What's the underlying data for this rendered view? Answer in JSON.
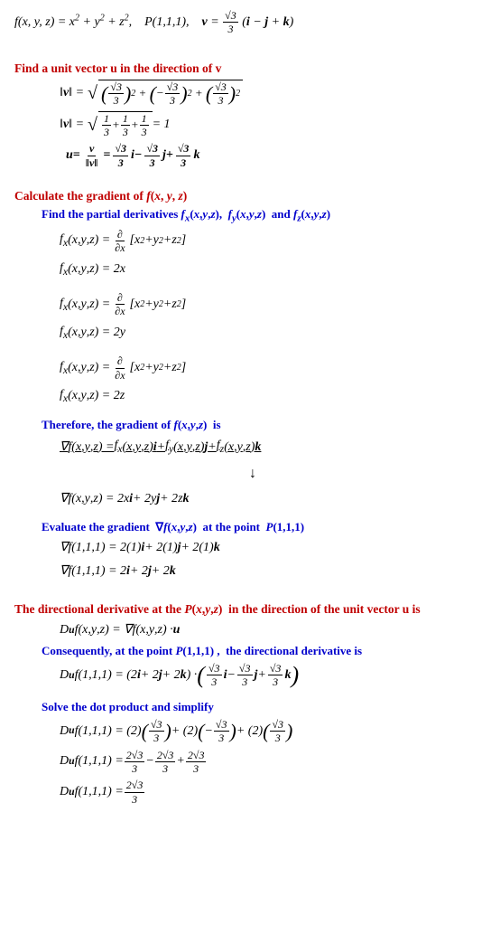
{
  "top": {
    "func_def": "f(x, y, z) = x² + y² + z²",
    "point_def": "P(1,1,1)",
    "v_def": "v = (√3/3)(i − j + k)"
  },
  "section1": {
    "title": "Find a unit vector u in the direction of v",
    "norm_eq1": "‖v‖ = √( (√3/3)² + (−√3/3)² + (√3/3)² )",
    "norm_eq2": "‖v‖ = √(1/3 + 1/3 + 1/3) = 1",
    "u_eq": "u = v/‖v‖ = (√3/3)i − (√3/3)j + (√3/3)k"
  },
  "section2": {
    "title": "Calculate the gradient of f(x, y, z)",
    "subsection": "Find the partial derivatives fₓ(x,y,z), f_y(x,y,z) and f_z(x,y,z)",
    "fx1": "fₓ(x,y,z) = ∂/∂x [x² + y² + z²]",
    "fx2": "fₓ(x,y,z) = 2x",
    "fy1": "f_x(x,y,z) = ∂/∂x [x² + y² + z²]",
    "fy2": "f_x(x,y,z) = 2y",
    "fz1": "f_x(x,y,z) = ∂/∂x [x² + y² + z²]",
    "fz2": "f_x(x,y,z) = 2z",
    "therefore": "Therefore, the gradient of f(x,y,z) is",
    "grad_def": "∇f(x,y,z) = fₓ(x,y,z)i + f_y(x,y,z)j + f_z(x,y,z)k",
    "grad_result": "∇f(x,y,z) = 2xi + 2yj + 2zk",
    "evaluate_title": "Evaluate the gradient ∇f(x,y,z) at the point P(1,1,1)",
    "eval1": "∇f(1,1,1) = 2(1)i + 2(1)j + 2(1)k",
    "eval2": "∇f(1,1,1) = 2i + 2j + 2k"
  },
  "section3": {
    "title": "The directional derivative at the P(x,y,z) in the direction of the unit vector u is",
    "formula": "D_uf(x,y,z) = ∇f(x,y,z)·u",
    "consequently": "Consequently, at the point P(1,1,1), the directional derivative is",
    "dot_eq": "D_uf(1,1,1) = (2i + 2j + 2k)·( (√3/3)i − (√3/3)j + (√3/3)k )",
    "solve_title": "Solve the dot product and simplify",
    "solve_eq": "D_uf(1,1,1) = (2)(√3/3) + (2)(−√3/3) + (2)(√3/3)",
    "simplify_eq": "D_uf(1,1,1) = 2√3/3 − 2√3/3 + 2√3/3",
    "result": "D_uf(1,1,1) = 2√3/3"
  }
}
